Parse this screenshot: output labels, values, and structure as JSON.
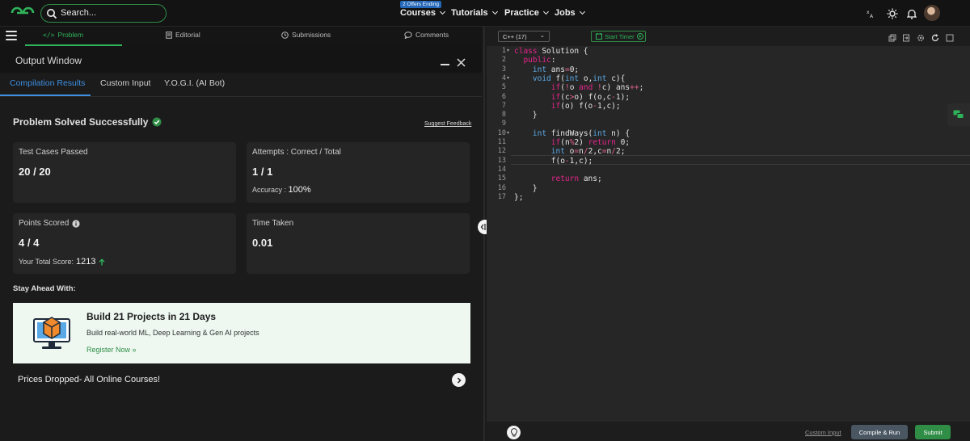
{
  "header": {
    "search_placeholder": "Search...",
    "nav": [
      {
        "label": "Courses",
        "badge": "2 Offers Ending"
      },
      {
        "label": "Tutorials"
      },
      {
        "label": "Practice"
      },
      {
        "label": "Jobs"
      }
    ]
  },
  "subnav": {
    "tabs": [
      "Problem",
      "Editorial",
      "Submissions",
      "Comments"
    ]
  },
  "output": {
    "title": "Output Window",
    "tabs": [
      "Compilation Results",
      "Custom Input",
      "Y.O.G.I. (AI Bot)"
    ],
    "status": "Problem Solved Successfully",
    "feedback_link": "Suggest Feedback",
    "cards": {
      "tests_label": "Test Cases Passed",
      "tests_value": "20 / 20",
      "attempts_label": "Attempts : Correct / Total",
      "attempts_value": "1 / 1",
      "accuracy_label": "Accuracy :",
      "accuracy_value": "100%",
      "points_label": "Points Scored",
      "points_value": "4 / 4",
      "total_label": "Your Total Score:",
      "total_value": "1213",
      "time_label": "Time Taken",
      "time_value": "0.01"
    },
    "stay_ahead": "Stay Ahead With:",
    "banner": {
      "title": "Build 21 Projects in 21 Days",
      "subtitle": "Build real-world ML, Deep Learning & Gen AI projects",
      "cta": "Register Now »"
    },
    "prices_text": "Prices Dropped- All Online Courses!"
  },
  "editor": {
    "language": "C++ (17)",
    "timer_label": "Start Timer",
    "code_lines": [
      "class Solution {",
      "  public:",
      "    int ans=0;",
      "    void f(int o,int c){",
      "        if(!o and !c) ans++;",
      "        if(c>o) f(o,c-1);",
      "        if(o) f(o-1,c);",
      "    }",
      "",
      "    int findWays(int n) {",
      "        if(n%2) return 0;",
      "        int o=n/2,c=n/2;",
      "        f(o-1,c);",
      "",
      "        return ans;",
      "    }",
      "};"
    ],
    "custom_input": "Custom Input",
    "compile_label": "Compile & Run",
    "submit_label": "Submit"
  },
  "colors": {
    "accent_green": "#2f8d46",
    "tab_blue": "#3d8fe0",
    "keyword": "#e8248d",
    "type": "#5aa9e6"
  }
}
